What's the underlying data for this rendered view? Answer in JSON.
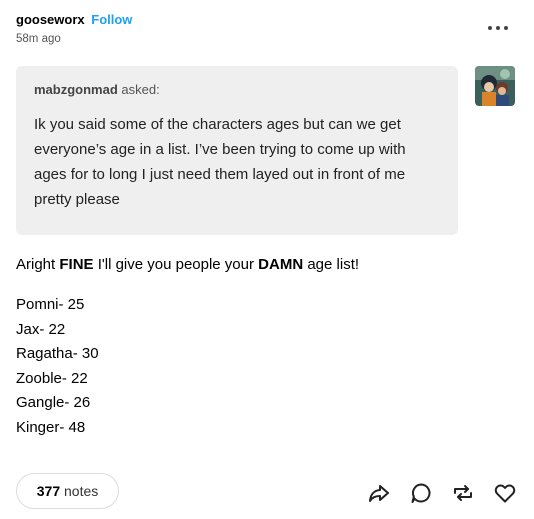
{
  "post": {
    "author": "gooseworx",
    "follow_label": "Follow",
    "timestamp": "58m ago",
    "more_icon": "more-horizontal-icon"
  },
  "ask": {
    "asker": "mabzgonmad",
    "asked_label": "asked:",
    "text": "Ik you said some of the characters ages but can we get everyone’s age in a list. I’ve been trying to come up with ages for to long I just need them layed out in front of me pretty please"
  },
  "answer": {
    "intro_1": "Aright ",
    "intro_bold_1": "FINE",
    "intro_2": " I'll give you people your ",
    "intro_bold_2": "DAMN",
    "intro_3": " age list!",
    "ages": [
      "Pomni- 25",
      "Jax- 22",
      "Ragatha- 30",
      "Zooble- 22",
      "Gangle- 26",
      "Kinger- 48"
    ]
  },
  "footer": {
    "notes_count": "377",
    "notes_label": "notes",
    "icons": [
      "share-icon",
      "reply-icon",
      "reblog-icon",
      "like-icon"
    ]
  },
  "colors": {
    "follow": "#1da1f2",
    "ask_background": "#efefef",
    "text": "#000000"
  }
}
